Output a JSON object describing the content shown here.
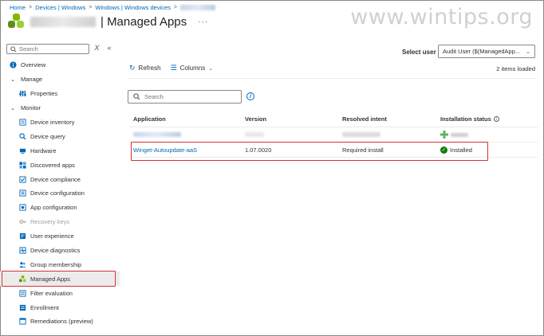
{
  "breadcrumb": {
    "items": [
      "Home",
      "Devices | Windows",
      "Windows | Windows devices"
    ]
  },
  "header": {
    "title": "| Managed Apps",
    "more": "···"
  },
  "watermark": "www.wintips.org",
  "sidebar": {
    "search_placeholder": "Search",
    "items": [
      {
        "label": "Overview",
        "icon": "info-icon"
      },
      {
        "label": "Manage",
        "icon": "chevron-down-icon"
      },
      {
        "label": "Properties",
        "icon": "properties-icon"
      },
      {
        "label": "Monitor",
        "icon": "chevron-down-icon"
      },
      {
        "label": "Device inventory",
        "icon": "inventory-icon"
      },
      {
        "label": "Device query",
        "icon": "query-icon"
      },
      {
        "label": "Hardware",
        "icon": "hardware-icon"
      },
      {
        "label": "Discovered apps",
        "icon": "apps-icon"
      },
      {
        "label": "Device compliance",
        "icon": "compliance-icon"
      },
      {
        "label": "Device configuration",
        "icon": "configuration-icon"
      },
      {
        "label": "App configuration",
        "icon": "app-config-icon"
      },
      {
        "label": "Recovery keys",
        "icon": "key-icon"
      },
      {
        "label": "User experience",
        "icon": "user-experience-icon"
      },
      {
        "label": "Device diagnostics",
        "icon": "diagnostics-icon"
      },
      {
        "label": "Group membership",
        "icon": "group-icon"
      },
      {
        "label": "Managed Apps",
        "icon": "managed-apps-icon"
      },
      {
        "label": "Filter evaluation",
        "icon": "filter-icon"
      },
      {
        "label": "Enrollment",
        "icon": "enrollment-icon"
      },
      {
        "label": "Remediations (preview)",
        "icon": "remediations-icon"
      }
    ]
  },
  "toolbar": {
    "refresh_label": "Refresh",
    "columns_label": "Columns"
  },
  "select_user": {
    "label": "Select user",
    "value": "Audit User ($(ManagedApp..."
  },
  "items_loaded": "2 items loaded",
  "main_search_placeholder": "Search",
  "table": {
    "columns": [
      "Application",
      "Version",
      "Resolved intent",
      "Installation status"
    ],
    "rows": [
      {
        "application": "Winget-Autoupdate-aaS",
        "version": "1.07.0020",
        "intent": "Required install",
        "status": "Installed"
      }
    ]
  },
  "colors": {
    "accent": "#0067b8",
    "highlight": "#d13438",
    "success": "#107c10"
  }
}
